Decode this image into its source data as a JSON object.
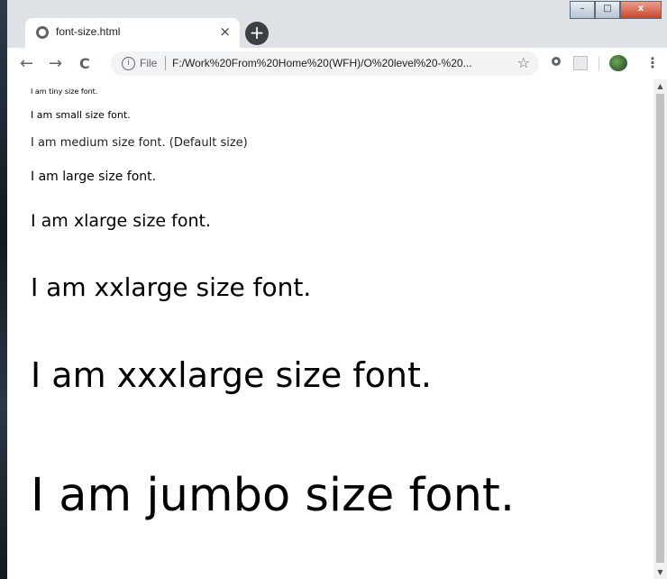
{
  "browser": {
    "tab_title": "font-size.html",
    "tab_close": "×",
    "new_tab": "+",
    "scheme_label": "File",
    "url": "F:/Work%20From%20Home%20(WFH)/O%20level%20-%20..."
  },
  "window_controls": {
    "minimize": "–",
    "maximize": "□",
    "close": "x"
  },
  "nav": {
    "back": "←",
    "forward": "→",
    "reload": "C",
    "info": "i",
    "star": "☆",
    "menu": "⋮"
  },
  "page": {
    "lines": [
      "I am tiny size font.",
      "I am small size font.",
      "I am medium size font. (Default size)",
      "I am large size font.",
      "I am xlarge size font.",
      "I am xxlarge size font.",
      "I am xxxlarge size font.",
      "I am jumbo size font."
    ]
  },
  "icons": {
    "tab": "globe-icon",
    "ext1": "circle-extension-icon",
    "ext2": "pdf-extension-icon",
    "ext3": "earth-extension-icon"
  }
}
